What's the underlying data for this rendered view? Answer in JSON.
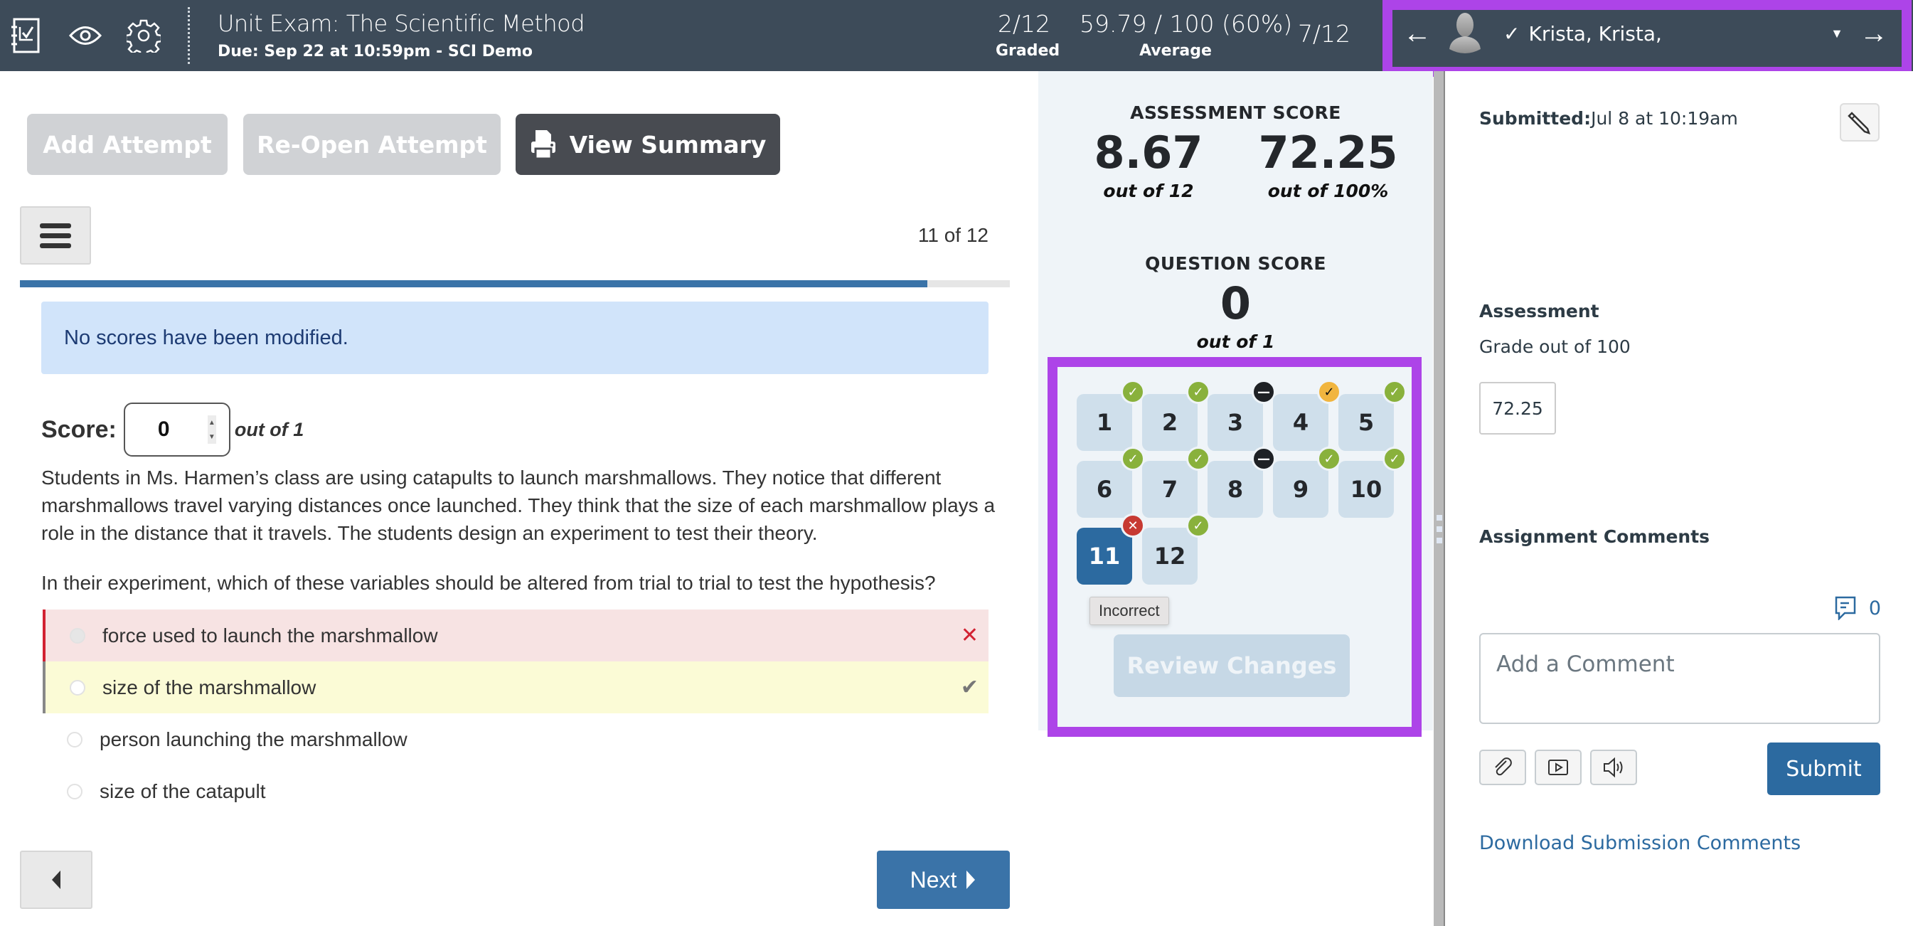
{
  "header": {
    "title": "Unit Exam: The Scientific Method",
    "subtitle": "Due: Sep 22 at 10:59pm - SCI Demo",
    "icons": [
      "assignment-icon",
      "eye-icon",
      "gear-icon"
    ],
    "graded": {
      "value": "2/12",
      "label": "Graded"
    },
    "average": {
      "value": "59.79 / 100 (60%)",
      "label": "Average"
    },
    "position": "7/12",
    "student": {
      "name": "Krista, Krista,",
      "check": "✓",
      "prev_arrow": "←",
      "next_arrow": "→",
      "caret": "▼"
    }
  },
  "toolbar": {
    "add_attempt": "Add Attempt",
    "reopen_attempt": "Re-Open Attempt",
    "view_summary": "View Summary"
  },
  "question_nav": {
    "counter": "11 of 12",
    "progress_fraction": 0.917
  },
  "alert": "No scores have been modified.",
  "score": {
    "label": "Score:",
    "value": "0",
    "out_of": "out of 1"
  },
  "question": {
    "text": "Students in Ms. Harmen’s class are using catapults to launch marshmallows. They notice that different marshmallows travel varying distances once launched. They think that the size of each marshmallow plays a role in the distance that it travels. The students design an experiment to test their theory.",
    "prompt": "In their experiment, which of these variables should be altered from trial to trial to test the hypothesis?",
    "answers": [
      {
        "label": "force used to launch the marshmallow",
        "state": "incorrect",
        "mark": "✕"
      },
      {
        "label": "size of the marshmallow",
        "state": "correct",
        "mark": "✔"
      },
      {
        "label": "person launching the marshmallow",
        "state": "none",
        "mark": ""
      },
      {
        "label": "size of the catapult",
        "state": "none",
        "mark": ""
      }
    ]
  },
  "footer_nav": {
    "next": "Next"
  },
  "assessment_score": {
    "title": "ASSESSMENT SCORE",
    "points": "8.67",
    "points_out_of": "out of 12",
    "percent": "72.25",
    "percent_out_of": "out of 100%"
  },
  "question_score": {
    "title": "QUESTION SCORE",
    "value": "0",
    "out_of": "out of 1"
  },
  "question_tiles": [
    {
      "num": "1",
      "status": "correct"
    },
    {
      "num": "2",
      "status": "correct"
    },
    {
      "num": "3",
      "status": "ungraded"
    },
    {
      "num": "4",
      "status": "partial"
    },
    {
      "num": "5",
      "status": "correct"
    },
    {
      "num": "6",
      "status": "correct"
    },
    {
      "num": "7",
      "status": "correct"
    },
    {
      "num": "8",
      "status": "ungraded"
    },
    {
      "num": "9",
      "status": "correct"
    },
    {
      "num": "10",
      "status": "correct"
    },
    {
      "num": "11",
      "status": "incorrect",
      "active": true
    },
    {
      "num": "12",
      "status": "correct"
    }
  ],
  "tooltip": "Incorrect",
  "review_changes": "Review Changes",
  "sidebar": {
    "submitted_label": "Submitted:",
    "submitted_value": "Jul 8 at 10:19am",
    "assessment_heading": "Assessment",
    "grade_label": "Grade out of 100",
    "grade_value": "72.25",
    "comments_heading": "Assignment Comments",
    "comment_count": "0",
    "comment_placeholder": "Add a Comment",
    "submit": "Submit",
    "download_link": "Download Submission Comments"
  },
  "colors": {
    "header_bg": "#3d4b59",
    "highlight": "#ad44e8",
    "primary": "#2c6aa0",
    "correct": "#89b13c",
    "incorrect": "#c73a32",
    "partial": "#f1b53f"
  }
}
